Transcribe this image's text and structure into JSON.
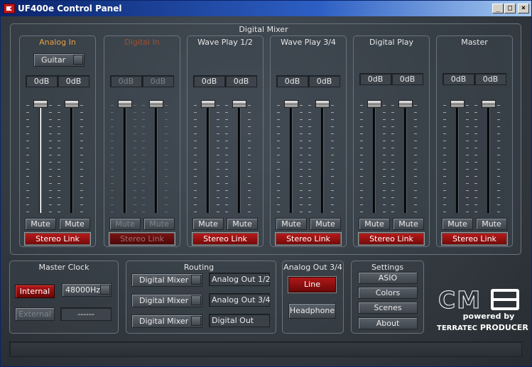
{
  "window": {
    "title": "UF400e Control Panel"
  },
  "mixer": {
    "title": "Digital Mixer",
    "channels": [
      {
        "name": "Analog In",
        "disabled": false,
        "source": "Guitar",
        "left_level": "0dB",
        "right_level": "0dB",
        "mute_left": "Mute",
        "mute_right": "Mute",
        "stereo_link": "Stereo Link"
      },
      {
        "name": "Digital In",
        "disabled": true,
        "left_level": "0dB",
        "right_level": "0dB",
        "mute_left": "Mute",
        "mute_right": "Mute",
        "stereo_link": "Stereo Link"
      },
      {
        "name": "Wave Play 1/2",
        "disabled": false,
        "left_level": "0dB",
        "right_level": "0dB",
        "mute_left": "Mute",
        "mute_right": "Mute",
        "stereo_link": "Stereo Link"
      },
      {
        "name": "Wave Play 3/4",
        "disabled": false,
        "left_level": "0dB",
        "right_level": "0dB",
        "mute_left": "Mute",
        "mute_right": "Mute",
        "stereo_link": "Stereo Link"
      },
      {
        "name": "Digital Play",
        "disabled": false,
        "left_level": "0dB",
        "right_level": "0dB",
        "mute_left": "Mute",
        "mute_right": "Mute",
        "stereo_link": "Stereo Link"
      },
      {
        "name": "Master",
        "disabled": false,
        "left_level": "0dB",
        "right_level": "0dB",
        "mute_left": "Mute",
        "mute_right": "Mute",
        "stereo_link": "Stereo Link"
      }
    ]
  },
  "master_clock": {
    "title": "Master Clock",
    "internal": "Internal",
    "external": "External",
    "rate": "48000Hz",
    "external_rate": "------"
  },
  "routing": {
    "title": "Routing",
    "rows": [
      {
        "source": "Digital Mixer",
        "dest": "Analog Out 1/2"
      },
      {
        "source": "Digital Mixer",
        "dest": "Analog Out 3/4"
      },
      {
        "source": "Digital Mixer",
        "dest": "Digital Out"
      }
    ]
  },
  "analog_out": {
    "title": "Analog Out 3/4",
    "line": "Line",
    "headphone": "Headphone"
  },
  "settings": {
    "title": "Settings",
    "asio": "ASIO",
    "colors": "Colors",
    "scenes": "Scenes",
    "about": "About"
  },
  "logo": {
    "mark": "CM",
    "powered": "powered by",
    "brand": "TERRATEC",
    "brand2": "PRODUCER"
  },
  "colors": {
    "accent_red": "#b01818",
    "label_orange": "#e8a040"
  }
}
